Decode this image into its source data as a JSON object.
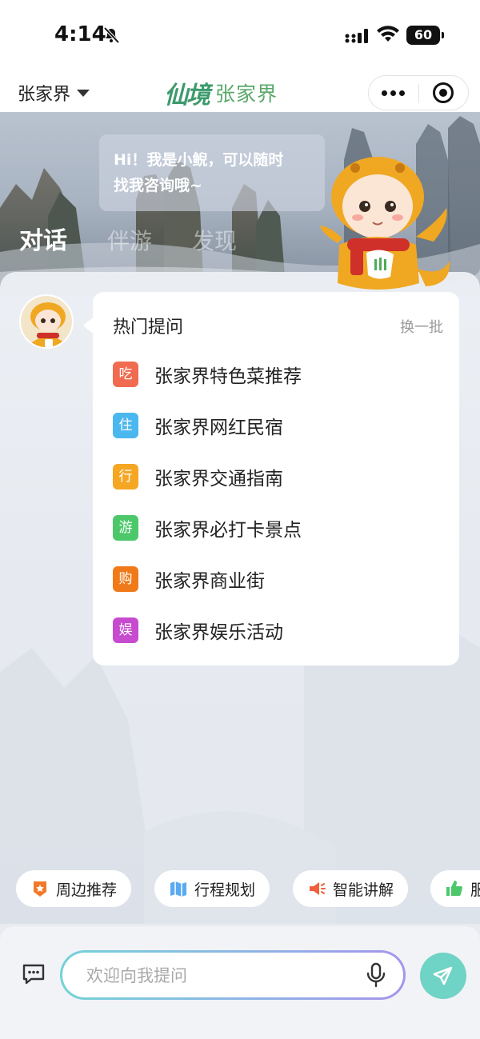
{
  "status_bar": {
    "time": "4:14",
    "battery": "60"
  },
  "nav": {
    "city": "张家界",
    "logo_script": "仙境",
    "logo_text": "张家界"
  },
  "hero": {
    "greeting_line1": "Hi！我是小鲵，可以随时",
    "greeting_line2": "找我咨询哦~",
    "tabs": [
      {
        "label": "对话"
      },
      {
        "label": "伴游"
      },
      {
        "label": "发现"
      }
    ]
  },
  "hot_questions": {
    "title": "热门提问",
    "refresh": "换一批",
    "items": [
      {
        "badge": "吃",
        "text": "张家界特色菜推荐",
        "color": "#f06b4f"
      },
      {
        "badge": "住",
        "text": "张家界网红民宿",
        "color": "#4bb7ef"
      },
      {
        "badge": "行",
        "text": "张家界交通指南",
        "color": "#f5a623"
      },
      {
        "badge": "游",
        "text": "张家界必打卡景点",
        "color": "#4cc86a"
      },
      {
        "badge": "购",
        "text": "张家界商业街",
        "color": "#f07a1a"
      },
      {
        "badge": "娱",
        "text": "张家界娱乐活动",
        "color": "#c64bcf"
      }
    ]
  },
  "chips": [
    {
      "label": "周边推荐",
      "icon": "star-badge-icon"
    },
    {
      "label": "行程规划",
      "icon": "map-icon"
    },
    {
      "label": "智能讲解",
      "icon": "speaker-icon"
    },
    {
      "label": "服",
      "icon": "thumbs-up-icon"
    }
  ],
  "input": {
    "placeholder": "欢迎向我提问"
  },
  "colors": {
    "accent": "#6fd3c5",
    "brand_green": "#5aa86a"
  }
}
